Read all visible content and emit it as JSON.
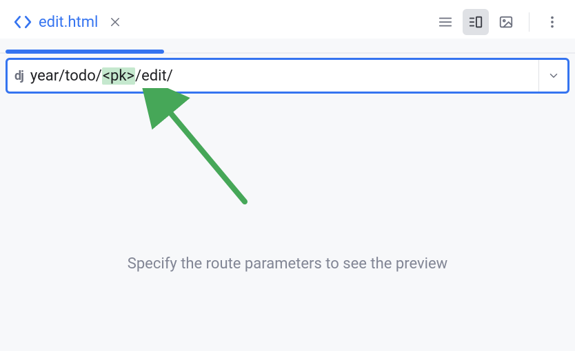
{
  "tab": {
    "label": "edit.html",
    "icon": "code-angle-brackets"
  },
  "toolbar": {
    "view_list_icon": "list-view",
    "view_split_icon": "split-view",
    "view_image_icon": "image-view",
    "more_icon": "more-vertical"
  },
  "url_bar": {
    "prefix": "dj",
    "path_before_param": "year/todo/",
    "param": "<pk>",
    "path_after_param": "/edit/",
    "dropdown_icon": "chevron-down"
  },
  "preview": {
    "empty_message": "Specify the route parameters to see the preview"
  },
  "annotation": {
    "arrow_color": "#4caf50"
  }
}
